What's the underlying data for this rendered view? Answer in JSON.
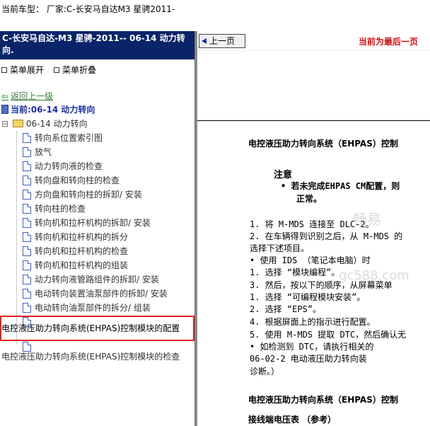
{
  "topbar": {
    "label": "当前车型： 厂家:C-长安马自达M3 星骋2011-"
  },
  "left": {
    "header": "C-长安马自达-M3 星骋-2011-- 06-14 动力转向.",
    "expand_label": "菜单展开",
    "collapse_label": "菜单折叠",
    "back_label": "返回上一级",
    "current_label": "当前:06-14 动力转向",
    "folder_label": "06-14 动力转向",
    "items": [
      "转向系位置索引图",
      "放气",
      "动力转向液的检查",
      "转向盘和转向柱的检查",
      "方向盘和转向柱的拆卸/ 安装",
      "转向柱的检查",
      "转向机和拉杆机构的拆卸/ 安装",
      "转向机和拉杆机构的拆分",
      "转向机和拉杆机构的检查",
      "转向机和拉杆机构的组装",
      "动力转向液管路组件的拆卸/ 安装",
      "电动转向装置油泵部件的拆卸/ 安装",
      "电动转向油泵部件的拆分/ 组装"
    ],
    "selected_item": "电控液压助力转向系统(EHPAS)控制模块的配置",
    "last_item": "电控液压助力转向系统(EHPAS)控制模块的检查"
  },
  "right": {
    "prev_button": "上一页",
    "last_page_notice": "当前为最后一页",
    "title": "电控液压助力转向系统（EHPAS）控制",
    "note_title": "注意",
    "note_line1": "• 若未完成EHPAS CM配置，则",
    "note_line2": "正常。",
    "steps": [
      "1. 将 M-MDS 连接至 DLC-2。",
      "2. 在车辆得到识别之后，从 M-MDS 的",
      "   选择下述项目。",
      "   • 使用 IDS （笔记本电脑）时",
      "     1. 选择 “模块编程”。",
      "3. 然后，按以下的顺序，从屏幕菜单",
      "   1. 选择 “可编程模块安装”。",
      "   2. 选择 “EPS”。",
      "4. 根据屏面上的指示进行配置。",
      "5. 使用 M-MDS 提取 DTC，然后确认无",
      "   • 如检测到 DTC，请执行相关的",
      "     06-02-2 电动液压助力转向装",
      "     诊断。）"
    ],
    "section_title": "电控液压助力转向系统（EHPAS）控制",
    "table_title": "接线端电压表 （参考）",
    "watermark1": "畅易",
    "watermark2": "qc588.com"
  }
}
